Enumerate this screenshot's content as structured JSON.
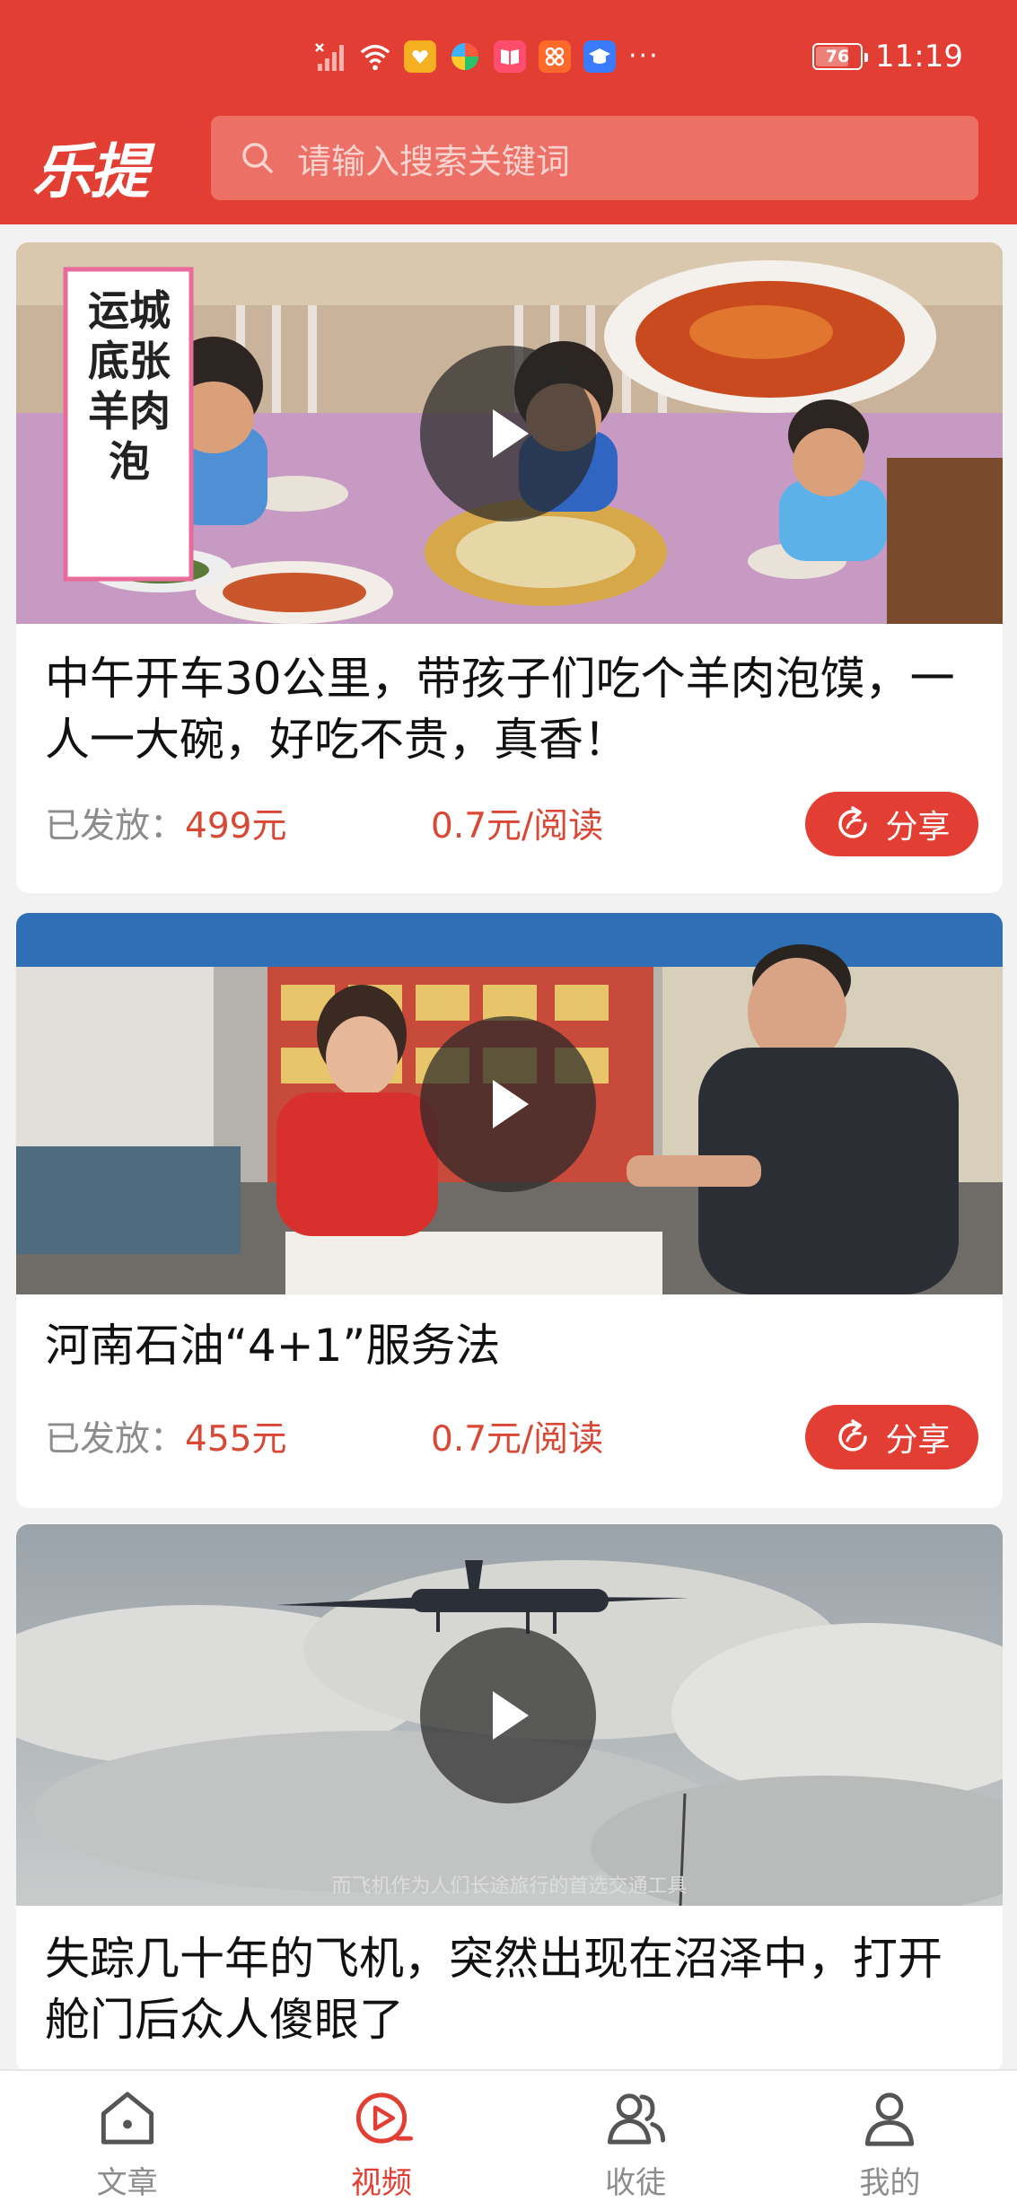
{
  "status_bar": {
    "time": "11:19",
    "battery": "76",
    "overflow": "···"
  },
  "header": {
    "logo": "乐提",
    "search_placeholder": "请输入搜索关键词"
  },
  "feed": [
    {
      "title": "中午开车30公里，带孩子们吃个羊肉泡馍，一人一大碗，好吃不贵，真香！",
      "paid_label": "已发放：",
      "paid_amount": "499元",
      "rate": "0.7元/阅读",
      "share_label": "分享",
      "thumb_text": "运城底张羊肉泡"
    },
    {
      "title": "河南石油“4+1”服务法",
      "paid_label": "已发放：",
      "paid_amount": "455元",
      "rate": "0.7元/阅读",
      "share_label": "分享"
    },
    {
      "title": "失踪几十年的飞机，突然出现在沼泽中，打开舱门后众人傻眼了",
      "video_caption": "而飞机作为人们长途旅行的首选交通工具"
    }
  ],
  "bottom_nav": [
    {
      "label": "文章",
      "icon": "article-icon",
      "active": false
    },
    {
      "label": "视频",
      "icon": "video-icon",
      "active": true
    },
    {
      "label": "收徒",
      "icon": "apprentice-icon",
      "active": false
    },
    {
      "label": "我的",
      "icon": "profile-icon",
      "active": false
    }
  ],
  "colors": {
    "brand": "#e33e33",
    "amount": "#d94735",
    "muted": "#8c8c8c"
  }
}
